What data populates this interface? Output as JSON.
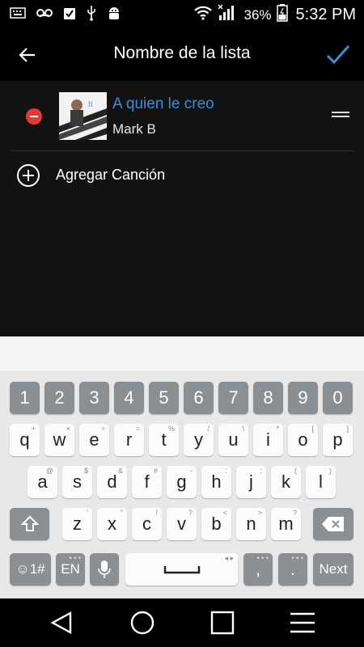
{
  "status_bar": {
    "battery_percent": "36%",
    "time": "5:32 PM",
    "icons": [
      "keyboard-icon",
      "voicemail-icon",
      "clipboard-check-icon",
      "usb-icon",
      "android-debug-icon",
      "wifi-icon",
      "signal-icon",
      "battery-icon"
    ]
  },
  "header": {
    "title": "Nombre de la lista",
    "accent_color": "#3a8fd6"
  },
  "playlist": {
    "songs": [
      {
        "title": "A quien le creo",
        "artist": "Mark B"
      }
    ],
    "add_label": "Agregar Canción"
  },
  "keyboard": {
    "row_numbers": [
      {
        "label": "1"
      },
      {
        "label": "2"
      },
      {
        "label": "3"
      },
      {
        "label": "4"
      },
      {
        "label": "5"
      },
      {
        "label": "6"
      },
      {
        "label": "7"
      },
      {
        "label": "8"
      },
      {
        "label": "9"
      },
      {
        "label": "0"
      }
    ],
    "row_1": [
      {
        "label": "q",
        "hint": "+"
      },
      {
        "label": "w",
        "hint": "×"
      },
      {
        "label": "e",
        "hint": "÷"
      },
      {
        "label": "r",
        "hint": "="
      },
      {
        "label": "t",
        "hint": "%"
      },
      {
        "label": "y",
        "hint": "/"
      },
      {
        "label": "u",
        "hint": "\\"
      },
      {
        "label": "i",
        "hint": "*"
      },
      {
        "label": "o",
        "hint": "["
      },
      {
        "label": "p",
        "hint": "]"
      }
    ],
    "row_2": [
      {
        "label": "a",
        "hint": "@"
      },
      {
        "label": "s",
        "hint": "$"
      },
      {
        "label": "d",
        "hint": "&"
      },
      {
        "label": "f",
        "hint": "#"
      },
      {
        "label": "g",
        "hint": "-"
      },
      {
        "label": "h",
        "hint": ":"
      },
      {
        "label": "j",
        "hint": ";"
      },
      {
        "label": "k",
        "hint": "("
      },
      {
        "label": "l",
        "hint": ")"
      }
    ],
    "row_3": [
      {
        "label": "z",
        "hint": "'"
      },
      {
        "label": "x",
        "hint": "\""
      },
      {
        "label": "c",
        "hint": "!"
      },
      {
        "label": "v",
        "hint": "?"
      },
      {
        "label": "b",
        "hint": "<"
      },
      {
        "label": "n",
        "hint": ">"
      },
      {
        "label": "m",
        "hint": "?"
      }
    ],
    "emoji_label": "☺1#",
    "lang_label": "EN",
    "comma_label": ",",
    "period_label": ".",
    "next_label": "Next"
  }
}
